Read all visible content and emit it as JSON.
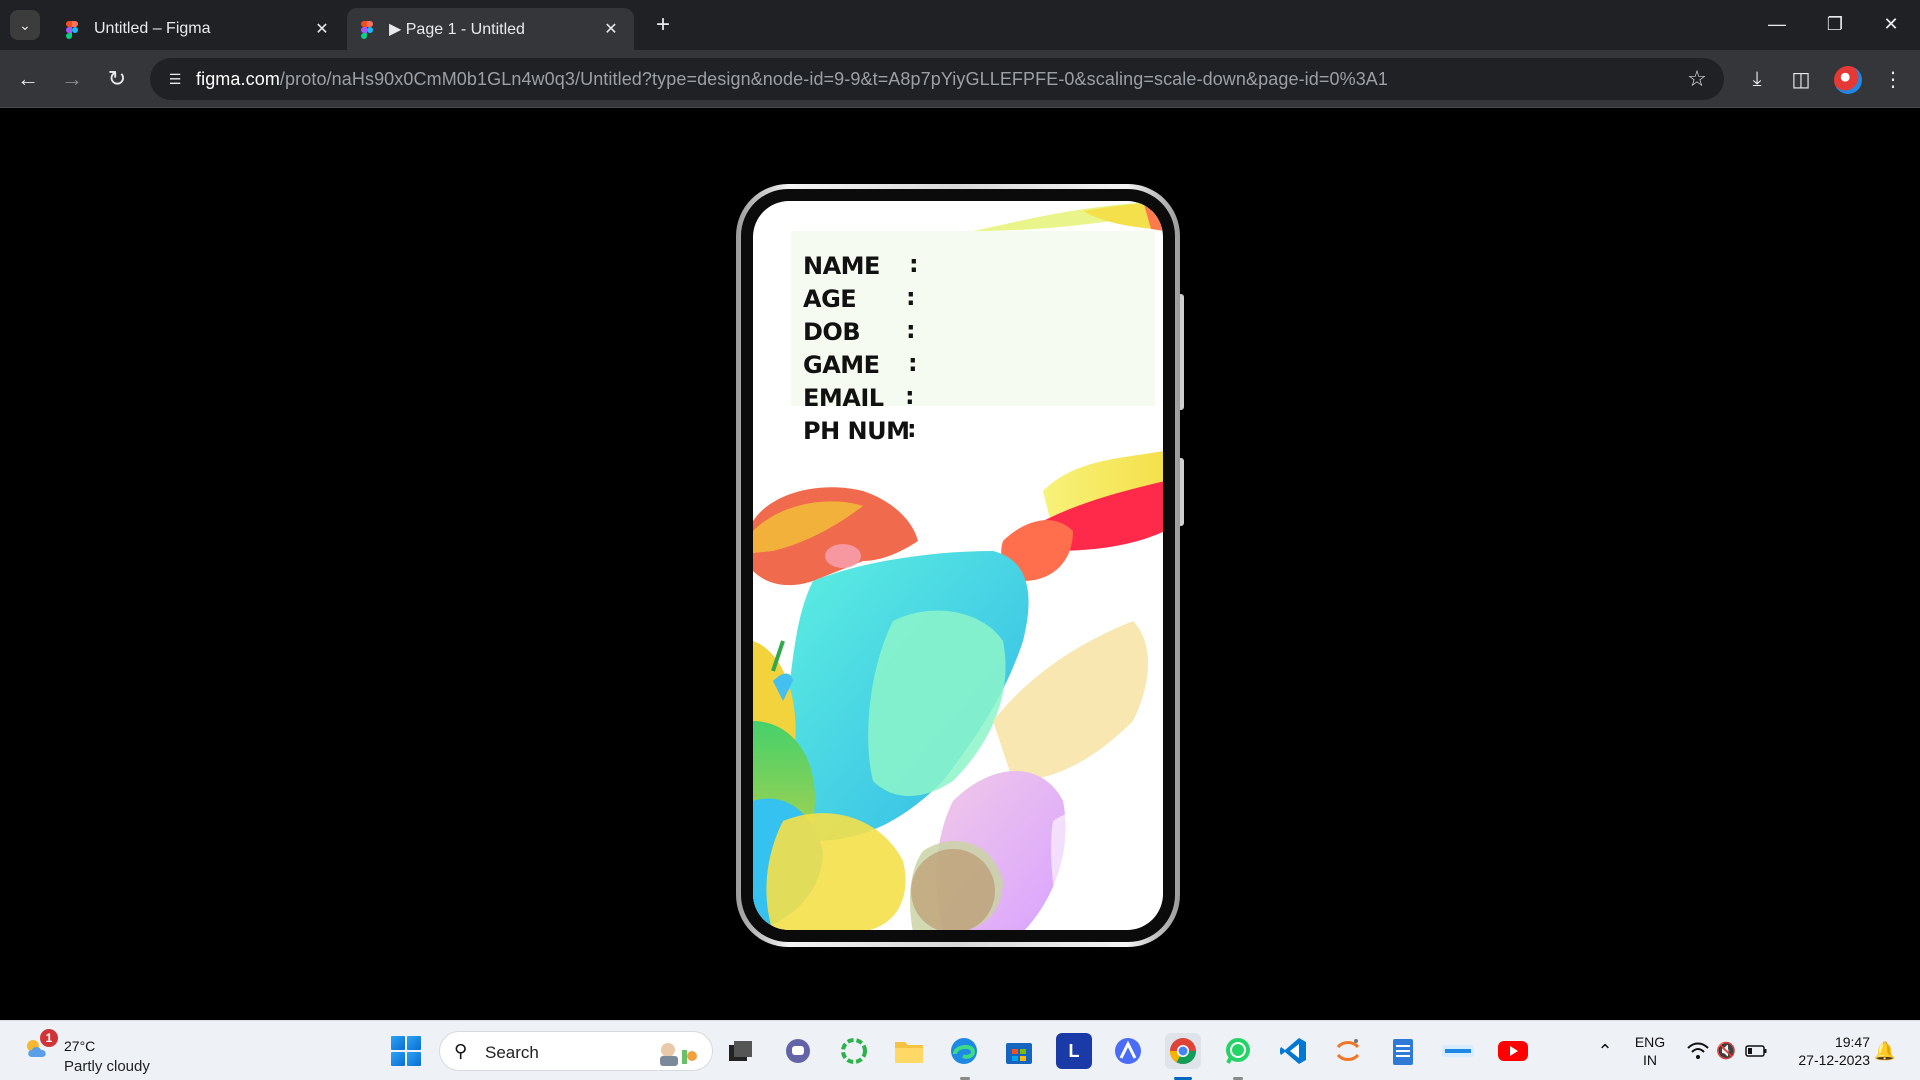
{
  "browser": {
    "tabs": [
      {
        "title": "Untitled – Figma",
        "active": false
      },
      {
        "title": "▶ Page 1 - Untitled",
        "active": true
      }
    ],
    "new_tab_label": "+",
    "address": {
      "host": "figma.com",
      "path": "/proto/naHs90x0CmM0b1GLn4w0q3/Untitled?type=design&node-id=9-9&t=A8p7pYiyGLLEFPFE-0&scaling=scale-down&page-id=0%3A1"
    },
    "icons": [
      "tab-search-icon",
      "back-icon",
      "forward-icon",
      "reload-icon",
      "site-info-icon",
      "bookmark-star-icon",
      "download-icon",
      "side-panel-icon",
      "profile-avatar-icon",
      "more-menu-icon",
      "minimize-icon",
      "restore-icon",
      "close-window-icon"
    ]
  },
  "prototype": {
    "fields": [
      {
        "label": "NAME",
        "colon": ":"
      },
      {
        "label": "AGE",
        "colon": ":"
      },
      {
        "label": "DOB",
        "colon": ":"
      },
      {
        "label": "GAME",
        "colon": ":"
      },
      {
        "label": "EMAIL",
        "colon": ":"
      },
      {
        "label": "PH NUM",
        "colon": ":"
      }
    ],
    "card_color": "#f6fbf1",
    "illustration": "abstract colorful athlete artwork"
  },
  "taskbar": {
    "weather": {
      "temp": "27°C",
      "condition": "Partly cloudy",
      "badge": "1"
    },
    "search_label": "Search",
    "apps": [
      "task-view",
      "teams-chat",
      "circular-app",
      "file-explorer",
      "edge",
      "microsoft-store",
      "l-app",
      "arc-app",
      "chrome",
      "whatsapp",
      "vscode",
      "jupyter",
      "notepad",
      "camu",
      "youtube"
    ],
    "tray": {
      "lang_top": "ENG",
      "lang_bottom": "IN",
      "time": "19:47",
      "date": "27-12-2023"
    }
  },
  "colors": {
    "accent": "#0067c0",
    "tab_bar": "#202124",
    "toolbar": "#35363a"
  }
}
